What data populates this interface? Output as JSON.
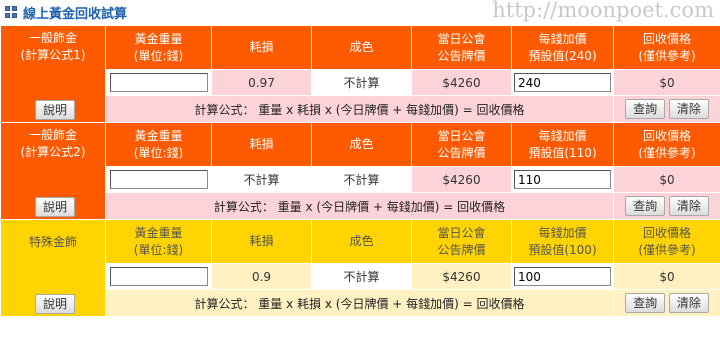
{
  "title": "線上黃金回收試算",
  "watermark": "http://moonpoet.com",
  "explain_label": "說明",
  "query_label": "查詢",
  "clear_label": "清除",
  "headers": {
    "weight": "黃金重量",
    "weight_unit": "(單位:錢)",
    "loss": "耗損",
    "purity": "成色",
    "price_1": "當日公會",
    "price_2": "公告牌價",
    "markup_1": "每錢加價",
    "recycle_1": "回收價格",
    "recycle_2": "(僅供參考)"
  },
  "sections": [
    {
      "name_1": "一般飾金",
      "name_2": "(計算公式1)",
      "markup_default": "預設值(240)",
      "weight_value": "",
      "loss": "0.97",
      "purity": "不計算",
      "price": "$4260",
      "markup_value": "240",
      "result": "$0",
      "formula": "計算公式： 重量 x 耗損 x (今日牌價 + 每錢加價) = 回收價格"
    },
    {
      "name_1": "一般飾金",
      "name_2": "(計算公式2)",
      "markup_default": "預設值(110)",
      "weight_value": "",
      "loss": "不計算",
      "purity": "不計算",
      "price": "$4260",
      "markup_value": "110",
      "result": "$0",
      "formula": "計算公式： 重量 x (今日牌價 + 每錢加價) = 回收價格"
    },
    {
      "name_1": "特殊金飾",
      "name_2": "",
      "markup_default": "預設值(100)",
      "weight_value": "",
      "loss": "0.9",
      "purity": "不計算",
      "price": "$4260",
      "markup_value": "100",
      "result": "$0",
      "formula": "計算公式： 重量 x 耗損 x (今日牌價 + 每錢加價) = 回收價格"
    }
  ],
  "colors": {
    "orange": "#ff5a00",
    "yellow": "#ffd400",
    "pink": "#fdd3da",
    "cream": "#fff1c2"
  }
}
